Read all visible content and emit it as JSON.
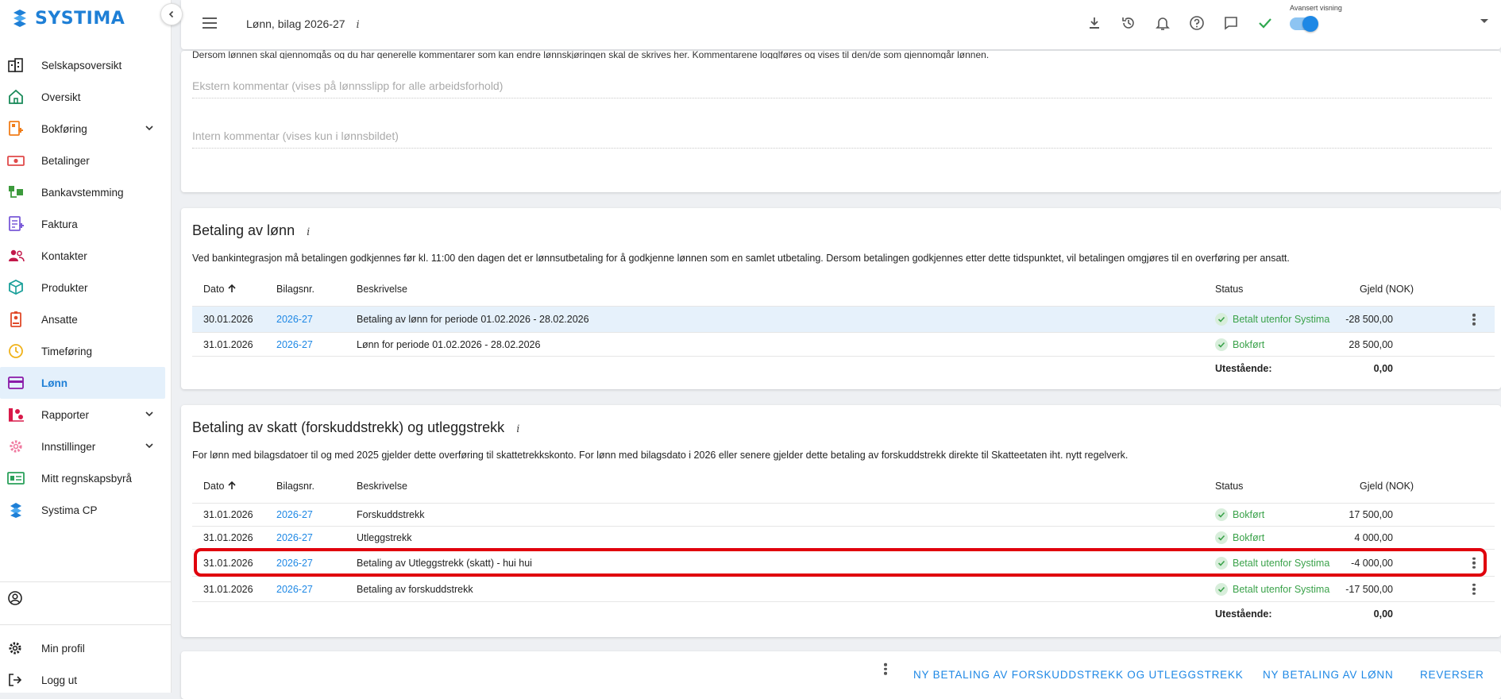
{
  "app": {
    "logo_text": "SYSTIMA",
    "accent": "#1e88e5"
  },
  "sidebar": {
    "items": [
      {
        "label": "Selskapsoversikt",
        "icon": "buildings-icon"
      },
      {
        "label": "Oversikt",
        "icon": "home-icon"
      },
      {
        "label": "Bokføring",
        "icon": "ledger-icon",
        "expandable": true
      },
      {
        "label": "Betalinger",
        "icon": "money-icon"
      },
      {
        "label": "Bankavstemming",
        "icon": "bank-icon"
      },
      {
        "label": "Faktura",
        "icon": "invoice-icon"
      },
      {
        "label": "Kontakter",
        "icon": "contacts-icon"
      },
      {
        "label": "Produkter",
        "icon": "box-icon"
      },
      {
        "label": "Ansatte",
        "icon": "badge-icon"
      },
      {
        "label": "Timeføring",
        "icon": "clock-icon"
      },
      {
        "label": "Lønn",
        "icon": "card-icon",
        "active": true
      },
      {
        "label": "Rapporter",
        "icon": "chart-icon",
        "expandable": true
      },
      {
        "label": "Innstillinger",
        "icon": "gear-icon",
        "expandable": true
      },
      {
        "label": "Mitt regnskapsbyrå",
        "icon": "id-card-icon"
      },
      {
        "label": "Systima CP",
        "icon": "systima-icon"
      }
    ],
    "bottom": {
      "profile": "Min profil",
      "logout": "Logg ut"
    }
  },
  "header": {
    "title": "Lønn, bilag 2026-27",
    "info": "i",
    "toggle_label": "Avansert visning",
    "toggle_on": true
  },
  "comments": {
    "hint": "Dersom lønnen skal gjennomgås og du har generelle kommentarer som kan endre lønnskjøringen skal de skrives her. Kommentarene logglføres og vises til den/de som gjennomgår lønnen.",
    "external_placeholder": "Ekstern kommentar (vises på lønnsslipp for alle arbeidsforhold)",
    "internal_placeholder": "Intern kommentar (vises kun i lønnsbildet)"
  },
  "columns": {
    "date": "Dato",
    "voucher": "Bilagsnr.",
    "description": "Beskrivelse",
    "status": "Status",
    "debt": "Gjeld (NOK)"
  },
  "salary_payment": {
    "title": "Betaling av lønn",
    "info": "i",
    "description": "Ved bankintegrasjon må betalingen godkjennes før kl. 11:00 den dagen det er lønnsutbetaling for å godkjenne lønnen som en samlet utbetaling. Dersom betalingen godkjennes etter dette tidspunktet, vil betalingen omgjøres til en overføring per ansatt.",
    "rows": [
      {
        "date": "30.01.2026",
        "voucher": "2026-27",
        "description": "Betaling av lønn for periode 01.02.2026 - 28.02.2026",
        "status": "Betalt utenfor Systima",
        "amount": "-28 500,00",
        "menu": true,
        "highlight": true
      },
      {
        "date": "31.01.2026",
        "voucher": "2026-27",
        "description": "Lønn for periode 01.02.2026 - 28.02.2026",
        "status": "Bokført",
        "amount": "28 500,00",
        "menu": false
      }
    ],
    "total_label": "Utestående:",
    "total": "0,00"
  },
  "tax_payment": {
    "title": "Betaling av skatt (forskuddstrekk) og utleggstrekk",
    "info": "i",
    "description": "For lønn med bilagsdatoer til og med 2025 gjelder dette overføring til skattetrekkskonto. For lønn med bilagsdato i 2026 eller senere gjelder dette betaling av forskuddstrekk direkte til Skatteetaten iht. nytt regelverk.",
    "rows": [
      {
        "date": "31.01.2026",
        "voucher": "2026-27",
        "description": "Forskuddstrekk",
        "status": "Bokført",
        "amount": "17 500,00",
        "menu": false
      },
      {
        "date": "31.01.2026",
        "voucher": "2026-27",
        "description": "Utleggstrekk",
        "status": "Bokført",
        "amount": "4 000,00",
        "menu": false
      },
      {
        "date": "31.01.2026",
        "voucher": "2026-27",
        "description": "Betaling av Utleggstrekk (skatt) - hui hui",
        "status": "Betalt utenfor Systima",
        "amount": "-4 000,00",
        "menu": true
      },
      {
        "date": "31.01.2026",
        "voucher": "2026-27",
        "description": "Betaling av forskuddstrekk",
        "status": "Betalt utenfor Systima",
        "amount": "-17 500,00",
        "menu": true
      }
    ],
    "total_label": "Utestående:",
    "total": "0,00"
  },
  "actions": {
    "new_tax_payment": "NY BETALING AV FORSKUDDSTREKK OG UTLEGGSTREKK",
    "new_salary_payment": "NY BETALING AV LØNN",
    "reverse": "REVERSER"
  }
}
